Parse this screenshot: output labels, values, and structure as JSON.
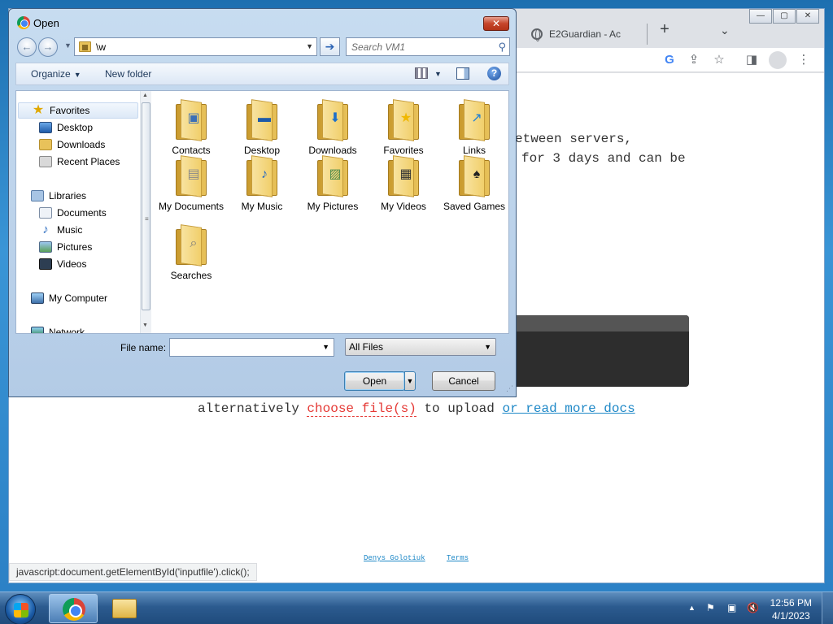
{
  "browser": {
    "tab_title": "E2Guardian - Ac",
    "new_tab_symbol": "+",
    "tab_search_symbol": "⌄",
    "window_buttons": [
      "—",
      "▢",
      "✕"
    ],
    "toolbar_icons": [
      "G",
      "share-icon",
      "star-icon",
      "sidebar-icon",
      "profile-icon",
      "menu-icon"
    ],
    "page": {
      "line1": "etween servers,",
      "line2": "for 3 days and can be",
      "alt_prefix": "alternatively ",
      "alt_choose": "choose file(s)",
      "alt_middle": " to upload ",
      "alt_docs": "or read more docs",
      "footer_author": "Denys Golotiuk",
      "footer_terms": "Terms"
    },
    "status_text": "javascript:document.getElementById('inputfile').click();"
  },
  "dialog": {
    "title": "Open",
    "close_symbol": "✕",
    "address_value": "\\w",
    "search_placeholder": "Search VM1",
    "organize_label": "Organize",
    "new_folder_label": "New folder",
    "nav": {
      "favorites": "Favorites",
      "desktop": "Desktop",
      "downloads": "Downloads",
      "recent_places": "Recent Places",
      "libraries": "Libraries",
      "documents": "Documents",
      "music": "Music",
      "pictures": "Pictures",
      "videos": "Videos",
      "my_computer": "My Computer",
      "network": "Network"
    },
    "folders": [
      {
        "label": "Contacts",
        "icon": "contacts-icon"
      },
      {
        "label": "Desktop",
        "icon": "desktop-icon"
      },
      {
        "label": "Downloads",
        "icon": "downloads-icon"
      },
      {
        "label": "Favorites",
        "icon": "favorites-icon"
      },
      {
        "label": "Links",
        "icon": "links-icon"
      },
      {
        "label": "My Documents",
        "icon": "my-documents-icon"
      },
      {
        "label": "My Music",
        "icon": "my-music-icon"
      },
      {
        "label": "My Pictures",
        "icon": "my-pictures-icon"
      },
      {
        "label": "My Videos",
        "icon": "my-videos-icon"
      },
      {
        "label": "Saved Games",
        "icon": "saved-games-icon"
      },
      {
        "label": "Searches",
        "icon": "searches-icon"
      }
    ],
    "file_name_label": "File name:",
    "file_name_value": "",
    "file_type_value": "All Files",
    "open_label": "Open",
    "cancel_label": "Cancel"
  },
  "taskbar": {
    "time": "12:56 PM",
    "date": "4/1/2023",
    "tray_arrow": "▲"
  }
}
